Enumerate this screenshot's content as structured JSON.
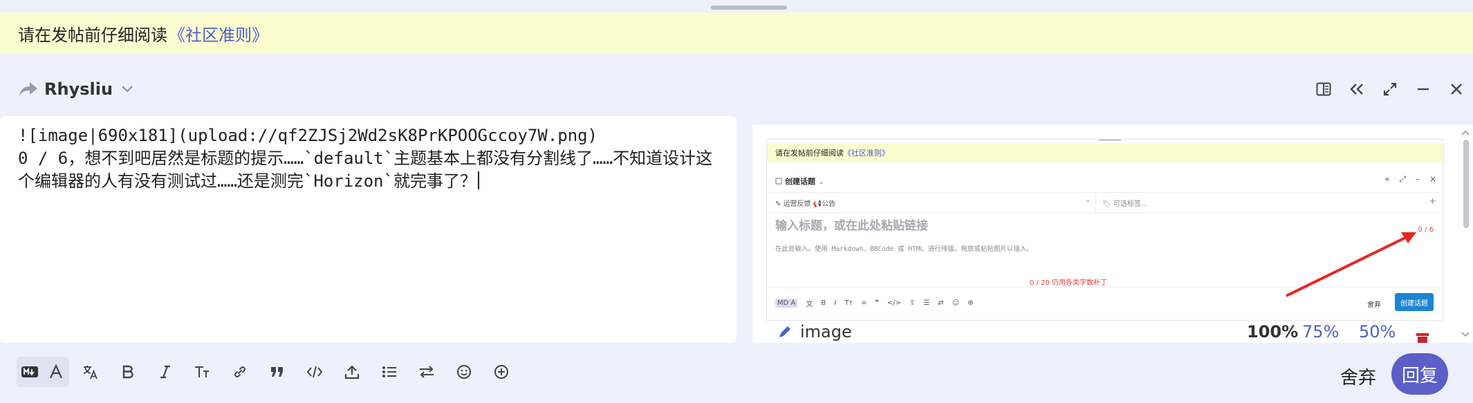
{
  "notice": {
    "text": "请在发帖前仔细阅读",
    "link": "《社区准则》"
  },
  "reply": {
    "username": "Rhysliu"
  },
  "editor": {
    "line1": "![image|690x181](upload://qf2ZJSj2Wd2sK8PrKPOOGccoy7W.png)",
    "line2": "0 / 6，想不到吧居然是标题的提示……`default`主题基本上都没有分割线了……不知道设计这个编辑器的人有没有测试过……还是测完`Horizon`就完事了？"
  },
  "preview": {
    "shot": {
      "notice_text": "请在发帖前仔细阅读",
      "notice_link": "《社区准则》",
      "create_topic": "创建话题",
      "category": "运营反馈",
      "category_tag": "公告",
      "tags_placeholder": "可选标签...",
      "title_placeholder": "输入标题，或在此处粘贴链接",
      "title_count": "0 / 6",
      "body_hint": "在此处输入。使用 Markdown、BBCode 或 HTML 进行排版。拖放或粘贴图片以插入。",
      "red_note": "0 / 20 仍用各类字数补丁",
      "discard": "舍弃",
      "create_btn": "创建话题"
    },
    "image_label": "image",
    "zoom": [
      "100%",
      "75%",
      "50%"
    ]
  },
  "toolbar": {
    "discard_label": "舍弃",
    "reply_label": "回复"
  },
  "colors": {
    "accent": "#5c5fc8",
    "link": "#4a5fcf",
    "notice_bg": "#fbfbd0",
    "annotation": "#e0443f"
  }
}
